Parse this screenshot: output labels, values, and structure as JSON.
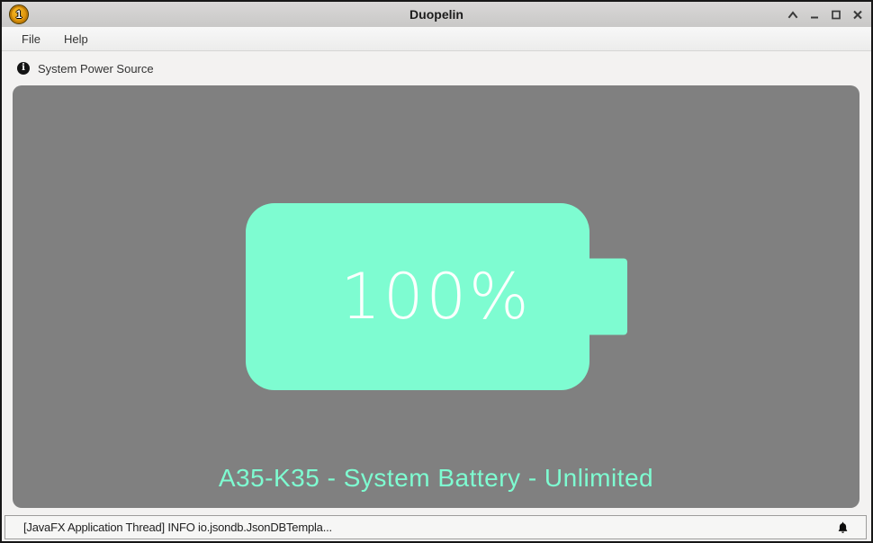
{
  "window": {
    "title": "Duopelin"
  },
  "menu": {
    "items": [
      "File",
      "Help"
    ]
  },
  "info_bar": {
    "icon": "info-circle-icon",
    "label": "System Power Source"
  },
  "battery": {
    "percent_label": "100%",
    "caption": "A35-K35 - System Battery - Unlimited"
  },
  "status_bar": {
    "message": "[JavaFX Application Thread] INFO io.jsondb.JsonDBTempla...",
    "icon": "bell-icon"
  },
  "icons": {
    "app_icon": "gold-coin-1",
    "app_icon_glyph": "1",
    "info_icon_glyph": "i",
    "window_controls": [
      "shade-icon",
      "minimize-icon",
      "maximize-icon",
      "close-icon"
    ]
  },
  "colors": {
    "battery_mint": "#7efcd1",
    "panel_gray": "#808080",
    "percent_text": "#fafffd",
    "titlebar_gray": "#d1d0cf",
    "status_bg": "#f6f6f5",
    "window_border": "#171717"
  }
}
